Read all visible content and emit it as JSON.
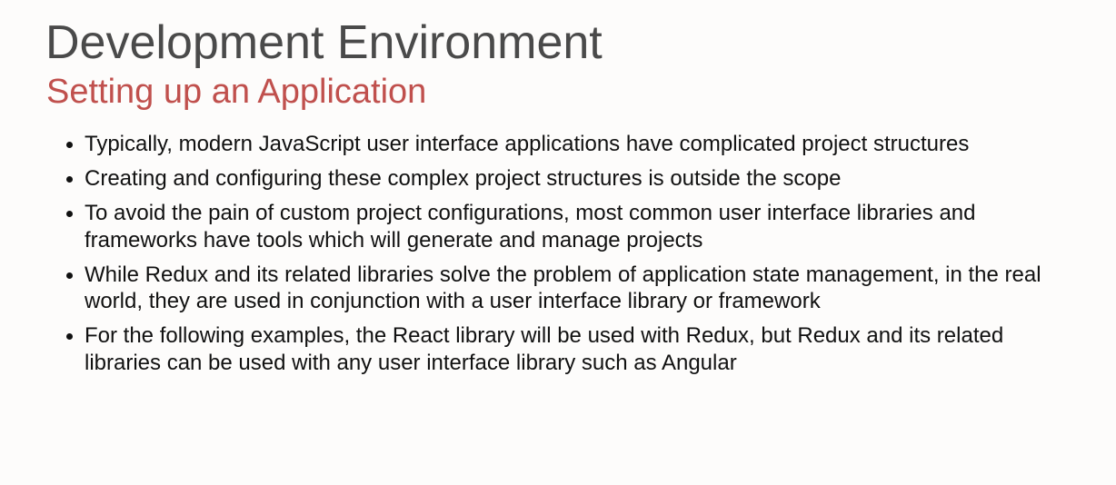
{
  "slide": {
    "title": "Development Environment",
    "subtitle": "Setting up an Application",
    "bullets": [
      "Typically, modern JavaScript user interface applications have complicated project structures",
      "Creating and configuring these complex project structures is outside the scope",
      "To avoid the pain of custom project configurations, most common user interface libraries and frameworks have tools which will generate and manage projects",
      "While Redux and its related libraries solve the problem of application state management, in the real world, they are used in conjunction with a user interface library or framework",
      "For the following examples, the React library will be used with Redux, but Redux and its related libraries can be used with any user interface library such as Angular"
    ]
  },
  "colors": {
    "background": "#fdfcfb",
    "title": "#4a4a4a",
    "subtitle": "#c0504d",
    "body_text": "#111111"
  }
}
